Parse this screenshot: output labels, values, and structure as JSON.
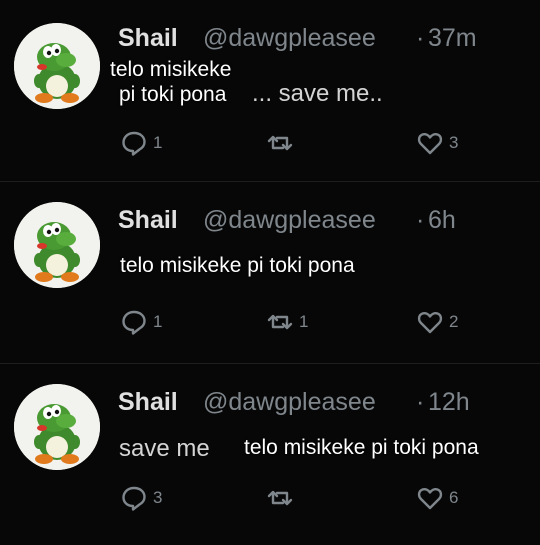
{
  "tweets": [
    {
      "name": "Shail",
      "handle": "@dawgpleasee",
      "separator": "·",
      "time": "37m",
      "caption_lines": [
        "telo misikeke",
        "pi toki pona"
      ],
      "original_text": "... save me..",
      "replies": "1",
      "retweets": "",
      "likes": "3"
    },
    {
      "name": "Shail",
      "handle": "@dawgpleasee",
      "separator": "·",
      "time": "6h",
      "caption_lines": [
        "telo misikeke pi toki pona"
      ],
      "original_text": "",
      "replies": "1",
      "retweets": "1",
      "likes": "2"
    },
    {
      "name": "Shail",
      "handle": "@dawgpleasee",
      "separator": "·",
      "time": "12h",
      "caption_lines": [
        "telo misikeke pi toki pona"
      ],
      "original_text": "save me",
      "replies": "3",
      "retweets": "",
      "likes": "6"
    }
  ],
  "colors": {
    "background": "#000000",
    "name": "#e0e0e0",
    "secondary": "#7f868c",
    "caption": "#ffffff",
    "avatar_character": "#3f8a2c"
  },
  "icons": [
    "avatar-character",
    "reply-icon",
    "retweet-icon",
    "like-icon"
  ]
}
